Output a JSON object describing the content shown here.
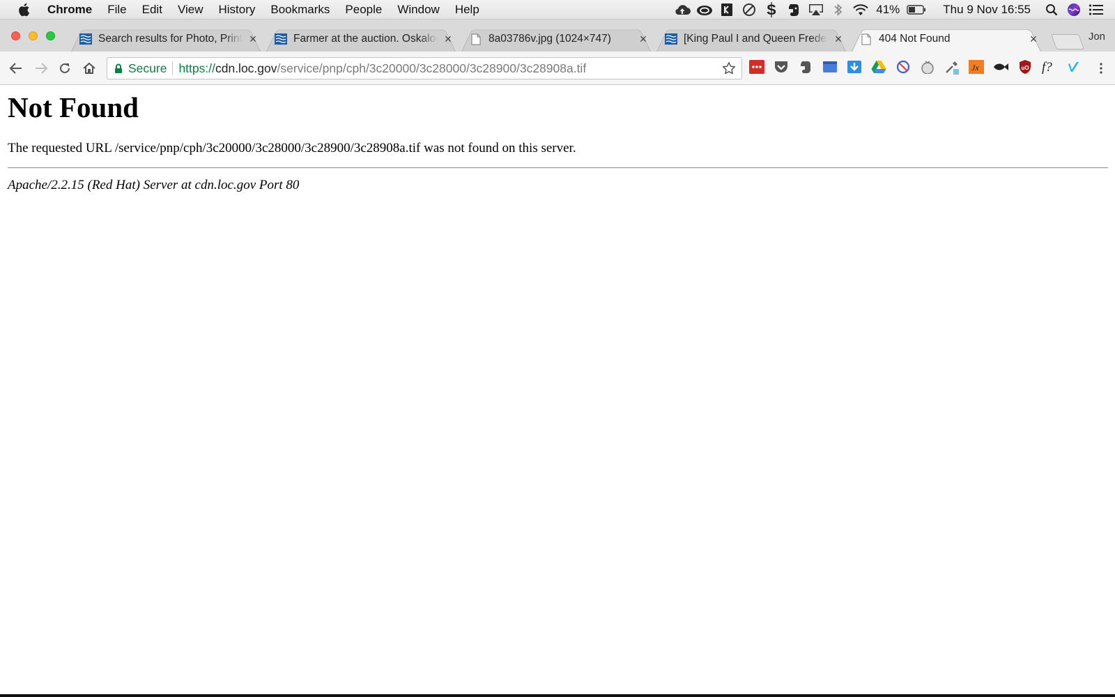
{
  "menubar": {
    "app_name": "Chrome",
    "items": [
      "File",
      "Edit",
      "View",
      "History",
      "Bookmarks",
      "People",
      "Window",
      "Help"
    ],
    "battery_text": "41%",
    "clock": "Thu 9 Nov  16:55",
    "status_icons": [
      "cloud-upload-icon",
      "creative-cloud-icon",
      "box-icon",
      "blocked-circle-icon",
      "s-icon",
      "evernote-icon",
      "airplay-icon",
      "bluetooth-icon",
      "wifi-icon",
      "battery-icon",
      "spotlight-search-icon",
      "siri-icon",
      "notification-center-icon"
    ]
  },
  "tabs": [
    {
      "title": "Search results for Photo, Print",
      "favicon": "loc-flag-icon",
      "active": false
    },
    {
      "title": "Farmer at the auction. Oskaloosa",
      "favicon": "loc-flag-icon",
      "active": false
    },
    {
      "title": "8a03786v.jpg (1024×747)",
      "favicon": "page-icon",
      "active": false
    },
    {
      "title": "[King Paul I and Queen Frederika",
      "favicon": "loc-flag-icon",
      "active": false
    },
    {
      "title": "404 Not Found",
      "favicon": "page-icon",
      "active": true
    }
  ],
  "profile_name": "Jon",
  "omnibox": {
    "secure_label": "Secure",
    "url_scheme": "https://",
    "url_host": "cdn.loc.gov",
    "url_path": "/service/pnp/cph/3c20000/3c28000/3c28900/3c28908a.tif"
  },
  "extensions": [
    "lastpass-icon",
    "pocket-icon",
    "evernote-icon",
    "window-icon",
    "download-icon",
    "google-drive-icon",
    "block-icon",
    "tomato-icon",
    "eyedropper-icon",
    "jx-icon",
    "fish-icon",
    "ublock-icon",
    "font-icon",
    "vimeo-icon"
  ],
  "page": {
    "heading": "Not Found",
    "message": "The requested URL /service/pnp/cph/3c20000/3c28000/3c28900/3c28908a.tif was not found on this server.",
    "server_address": "Apache/2.2.15 (Red Hat) Server at cdn.loc.gov Port 80"
  }
}
